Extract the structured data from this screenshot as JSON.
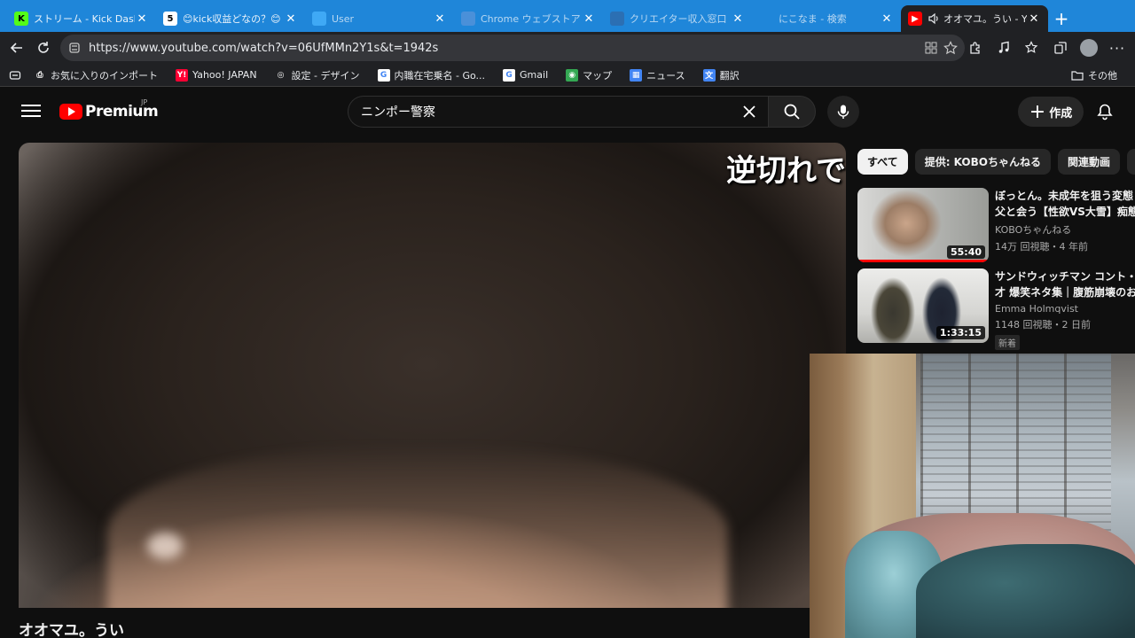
{
  "browser": {
    "tabs": [
      {
        "title": "ストリーム - Kick Dashboard",
        "favicon_color": "#53fc18",
        "favicon_text": "K",
        "favicon_text_color": "#000000",
        "dim": false
      },
      {
        "title": "😊kick収益どなの？😊 An",
        "favicon_color": "#ffffff",
        "favicon_text": "5",
        "favicon_text_color": "#000000",
        "dim": false
      },
      {
        "title": "User",
        "favicon_color": "#3fa9f5",
        "favicon_text": "",
        "favicon_text_color": "#ffffff",
        "dim": true
      },
      {
        "title": "Chrome ウェブストア - 拡張",
        "favicon_color": "#4a90d9",
        "favicon_text": "",
        "favicon_text_color": "#ffffff",
        "dim": true
      },
      {
        "title": "クリエイター収入窓口",
        "favicon_color": "#2b6fb3",
        "favicon_text": "",
        "favicon_text_color": "#ffffff",
        "dim": true
      },
      {
        "title": "にこなま - 検索",
        "favicon_color": "",
        "favicon_text": "",
        "favicon_text_color": "#ffffff",
        "dim": true
      },
      {
        "title": "オオマユ。うい - YouTube",
        "favicon_color": "#ff0000",
        "favicon_text": "▶",
        "favicon_text_color": "#ffffff",
        "dim": false,
        "active": true
      }
    ],
    "url": "https://www.youtube.com/watch?v=06UfMMn2Y1s&t=1942s",
    "bookmarks": [
      {
        "label": "お気に入りのインポート",
        "icon": "import-icon",
        "color": "#5f6368"
      },
      {
        "label": "Yahoo! JAPAN",
        "icon": "yahoo-icon",
        "color": "#ff0033"
      },
      {
        "label": "設定 - デザイン",
        "icon": "globe-icon",
        "color": "#5f6368"
      },
      {
        "label": "内職在宅乗名 - Go...",
        "icon": "google-icon",
        "color": "#ffffff"
      },
      {
        "label": "Gmail",
        "icon": "google-icon",
        "color": "#ffffff"
      },
      {
        "label": "マップ",
        "icon": "maps-icon",
        "color": "#34a853"
      },
      {
        "label": "ニュース",
        "icon": "news-icon",
        "color": "#4285f4"
      },
      {
        "label": "翻訳",
        "icon": "translate-icon",
        "color": "#4285f4"
      }
    ],
    "bookmarks_other": "その他"
  },
  "youtube": {
    "logo_text": "Premium",
    "logo_region": "JP",
    "search_query": "ニンポー警察",
    "create_label": "作成",
    "video_overlay_text": "逆切れで",
    "video_title": "オオマユ。うい",
    "chips": [
      {
        "label": "すべて",
        "active": true
      },
      {
        "label": "提供: KOBOちゃんねる",
        "active": false
      },
      {
        "label": "関連動画",
        "active": false
      }
    ],
    "recommendations": [
      {
        "title_line1": "ぼっとん。未成年を狙う変態",
        "title_line2": "父と会う【性欲VS大雪】痴態",
        "channel": "KOBOちゃんねる",
        "stats": "14万 回視聴・4 年前",
        "duration": "55:40",
        "badge": "",
        "watched": true
      },
      {
        "title_line1": "サンドウィッチマン コント・漫",
        "title_line2": "才 爆笑ネタ集｜腹筋崩壊のお",
        "channel": "Emma Holmqvist",
        "stats": "1148 回視聴・2 日前",
        "duration": "1:33:15",
        "badge": "新着",
        "watched": false
      }
    ]
  }
}
